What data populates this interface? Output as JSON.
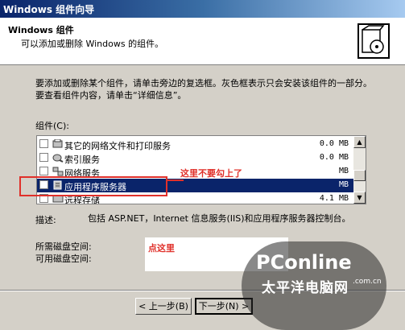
{
  "window": {
    "title": "Windows 组件向导"
  },
  "header": {
    "title": "Windows 组件",
    "subtitle": "可以添加或删除 Windows 的组件。"
  },
  "intro": "要添加或删除某个组件，请单击旁边的复选框。灰色框表示只会安装该组件的一部分。要查看组件内容，请单击“详细信息”。",
  "components_label": "组件(C):",
  "components": [
    {
      "name": "其它的网络文件和打印服务",
      "size": "0.0 MB",
      "selected": false,
      "icon": "network-printer-icon"
    },
    {
      "name": "索引服务",
      "size": "0.0 MB",
      "selected": false,
      "icon": "index-service-icon"
    },
    {
      "name": "网络服务",
      "size": "MB",
      "selected": false,
      "icon": "network-service-icon"
    },
    {
      "name": "应用程序服务器",
      "size": "MB",
      "selected": true,
      "icon": "application-server-icon"
    },
    {
      "name": "远程存储",
      "size": "4.1 MB",
      "selected": false,
      "icon": "remote-storage-icon"
    }
  ],
  "annotations": {
    "dont_check": "这里不要勾上了",
    "click_here": "点这里",
    "color": "#e0302a"
  },
  "description": {
    "label": "描述:",
    "text": "包括 ASP.NET，Internet 信息服务(IIS)和应用程序服务器控制台。"
  },
  "disk": {
    "required_label": "所需磁盘空间:",
    "available_label": "可用磁盘空间:"
  },
  "buttons": {
    "back": "< 上一步(B)",
    "next": "下一步(N) >"
  },
  "watermark": {
    "brand": "PConline",
    "domain": ".com.cn",
    "tagline": "太平洋电脑网"
  }
}
